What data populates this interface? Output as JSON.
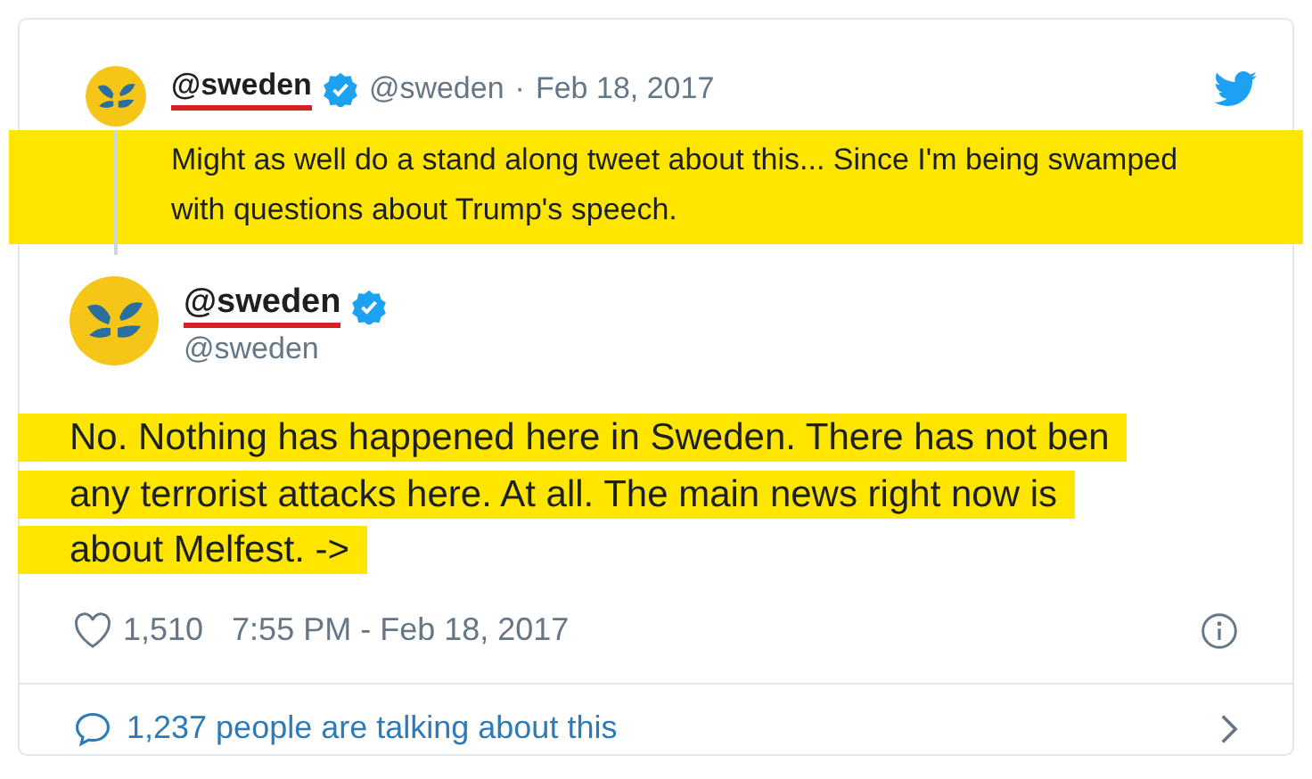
{
  "parent_tweet": {
    "display_name": "@sweden",
    "name_underlined": true,
    "verified": true,
    "handle": "@sweden",
    "separator": "·",
    "date": "Feb 18, 2017",
    "text": "Might as well do a stand along tweet about this... Since I'm being swamped with questions about Trump's speech.",
    "highlighted": true
  },
  "tweet": {
    "display_name": "@sweden",
    "name_underlined": true,
    "verified": true,
    "handle": "@sweden",
    "text": "No. Nothing has happened here in Sweden. There has not ben any terrorist attacks here. At all. The main news right now is about Melfest. ->",
    "highlighted": true
  },
  "footer": {
    "likes": "1,510",
    "timestamp": "7:55 PM - Feb 18, 2017"
  },
  "conversation_link": "1,237 people are talking about this"
}
